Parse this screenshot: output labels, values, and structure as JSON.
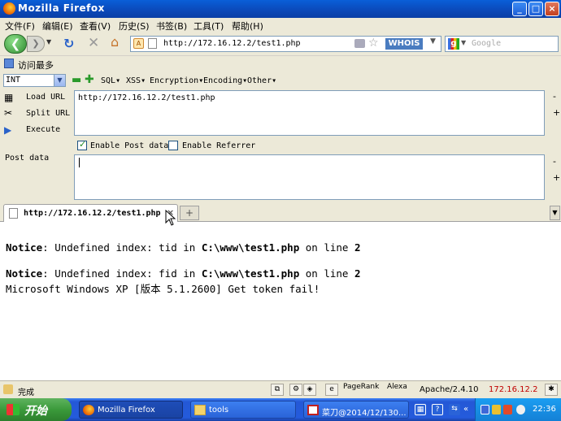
{
  "window": {
    "title": "Mozilla Firefox",
    "min_label": "_",
    "max_label": "□",
    "close_label": "×"
  },
  "menu": {
    "items": [
      "文件(F)",
      "编辑(E)",
      "查看(V)",
      "历史(S)",
      "书签(B)",
      "工具(T)",
      "帮助(H)"
    ]
  },
  "nav": {
    "url": "http://172.16.12.2/test1.php",
    "whois_label": "WHOIS",
    "search_placeholder": "Google",
    "back_glyph": "❮",
    "forward_glyph": "❯",
    "reload_glyph": "↻",
    "stop_glyph": "✕",
    "home_glyph": "⌂"
  },
  "bookmarks": {
    "label": "访问最多"
  },
  "hackbar": {
    "select_value": "INT",
    "menus": [
      "SQL",
      "XSS",
      "Encryption",
      "Encoding",
      "Other"
    ],
    "load_url": "Load URL",
    "split_url": "Split URL",
    "execute": "Execute",
    "url_value": "http://172.16.12.2/test1.php",
    "enable_post_label": "Enable Post data",
    "enable_post_checked": true,
    "enable_referrer_label": "Enable Referrer",
    "enable_referrer_checked": false,
    "post_data_label": "Post data",
    "post_value": ""
  },
  "tabs": [
    {
      "title": "http://172.16.12.2/test1.php",
      "active": true
    }
  ],
  "content": {
    "lines": [
      {
        "label": "Notice",
        "message": ": Undefined index: tid in ",
        "file": "C:\\www\\test1.php",
        "on_line": " on line ",
        "line": "2"
      },
      {
        "label": "Notice",
        "message": ": Undefined index: fid in ",
        "file": "C:\\www\\test1.php",
        "on_line": " on line ",
        "line": "2"
      }
    ],
    "output": "Microsoft Windows XP [版本 5.1.2600] Get token fail!"
  },
  "status": {
    "text": "完成",
    "pagerank_label": "PageRank",
    "alexa_label": "Alexa",
    "server": "Apache/2.4.10",
    "ip": "172.16.12.2"
  },
  "taskbar": {
    "start_label": "开始",
    "tasks": [
      {
        "label": "Mozilla Firefox",
        "active": true
      },
      {
        "label": "tools",
        "active": false
      },
      {
        "label": "菜刀@2014/12/130...",
        "active": false
      }
    ],
    "clock": "22:36"
  },
  "colors": {
    "titlebar": "#0b48b8",
    "chrome": "#ece9d8",
    "taskbar": "#245bdc",
    "ip_text": "#c00000"
  }
}
